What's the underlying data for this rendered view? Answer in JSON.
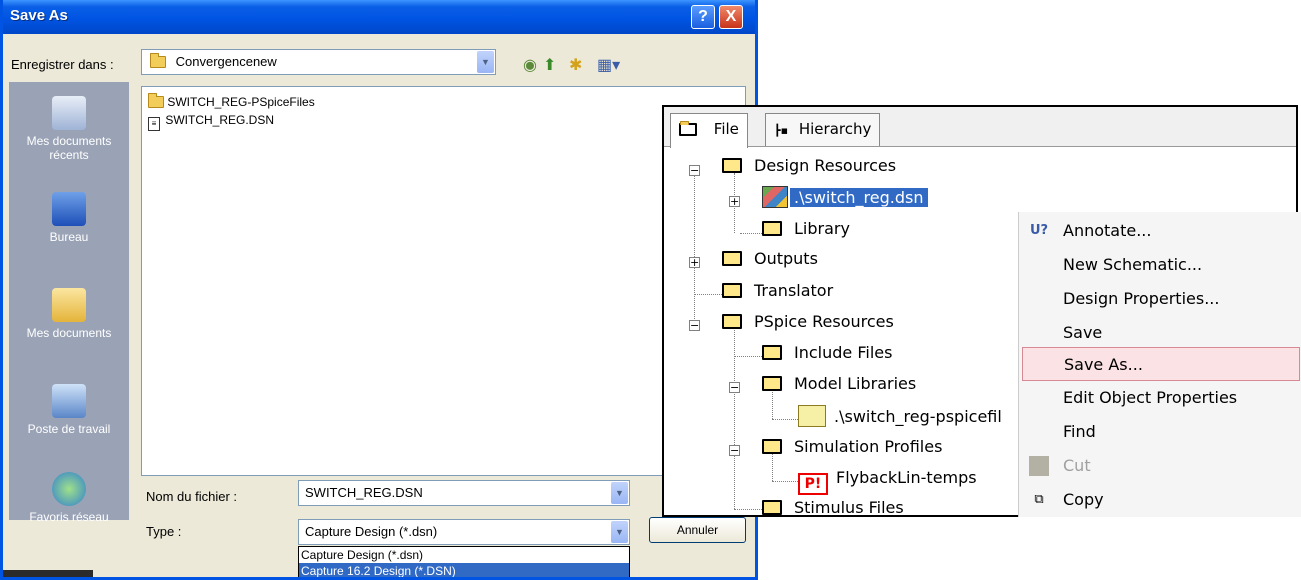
{
  "dialog": {
    "title": "Save As",
    "help_glyph": "?",
    "close_glyph": "X",
    "save_in_label": "Enregistrer dans :",
    "save_in_value": "Convergencenew",
    "places": [
      {
        "label_line1": "Mes documents",
        "label_line2": "récents"
      },
      {
        "label_line1": "Bureau",
        "label_line2": ""
      },
      {
        "label_line1": "Mes documents",
        "label_line2": ""
      },
      {
        "label_line1": "Poste de travail",
        "label_line2": ""
      },
      {
        "label_line1": "Favoris réseau",
        "label_line2": ""
      }
    ],
    "files": [
      {
        "name": "SWITCH_REG-PSpiceFiles",
        "kind": "folder"
      },
      {
        "name": "SWITCH_REG.DSN",
        "kind": "dsn"
      }
    ],
    "filename_label": "Nom du fichier :",
    "filename_value": "SWITCH_REG.DSN",
    "type_label": "Type :",
    "type_value": "Capture Design (*.dsn)",
    "cancel_label": "Annuler",
    "type_options": [
      "Capture Design (*.dsn)",
      "Capture 16.2 Design (*.DSN)"
    ],
    "colors": {
      "titlebar": "#0054e3",
      "selection": "#316ac5"
    }
  },
  "project": {
    "tabs": [
      {
        "label": "File",
        "active": true
      },
      {
        "label": "Hierarchy",
        "active": false
      }
    ],
    "tree": {
      "design_resources": "Design Resources",
      "design_file": ".\\switch_reg.dsn",
      "library": "Library",
      "outputs": "Outputs",
      "translator": "Translator",
      "pspice_resources": "PSpice Resources",
      "include_files": "Include Files",
      "model_libraries": "Model Libraries",
      "model_lib_file": ".\\switch_reg-pspicefil",
      "simulation_profiles": "Simulation Profiles",
      "sim_profile": "FlybackLin-temps",
      "stimulus_files": "Stimulus Files"
    }
  },
  "context_menu": {
    "items": [
      {
        "label": "Annotate...",
        "icon": "annotate-icon",
        "state": "normal"
      },
      {
        "label": "New Schematic...",
        "icon": "",
        "state": "normal"
      },
      {
        "label": "Design Properties...",
        "icon": "",
        "state": "normal"
      },
      {
        "label": "Save",
        "icon": "",
        "state": "normal"
      },
      {
        "label": "Save As...",
        "icon": "",
        "state": "hover"
      },
      {
        "label": "Edit Object Properties",
        "icon": "",
        "state": "normal"
      },
      {
        "label": "Find",
        "icon": "",
        "state": "normal"
      },
      {
        "label": "Cut",
        "icon": "cut-icon",
        "state": "disabled"
      },
      {
        "label": "Copy",
        "icon": "copy-icon",
        "state": "normal"
      }
    ],
    "hover_color": "#fbe2e5"
  }
}
